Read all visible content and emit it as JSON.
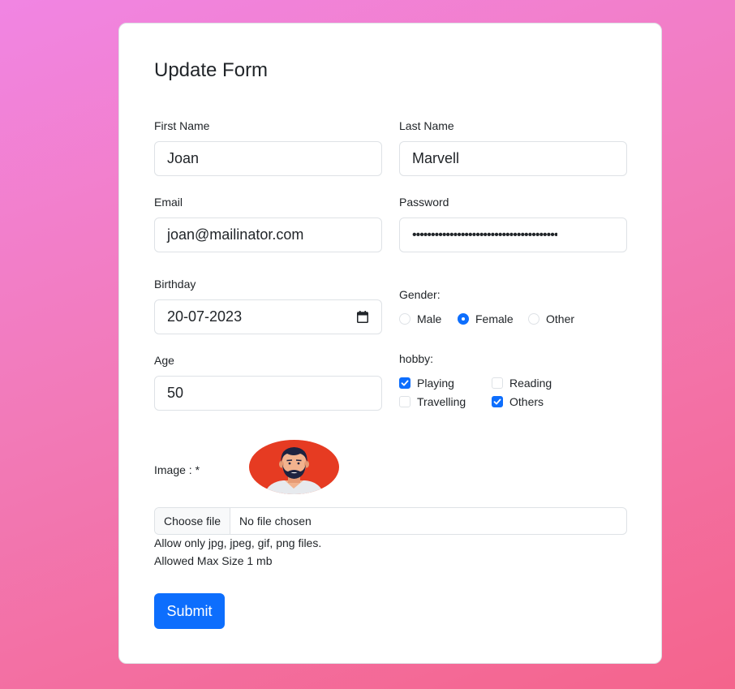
{
  "form": {
    "title": "Update Form",
    "first_name": {
      "label": "First Name",
      "value": "Joan"
    },
    "last_name": {
      "label": "Last Name",
      "value": "Marvell"
    },
    "email": {
      "label": "Email",
      "value": "joan@mailinator.com"
    },
    "password": {
      "label": "Password",
      "value": "•••••••••••••••••••••••••••••••••••••••"
    },
    "birthday": {
      "label": "Birthday",
      "value": "20-07-2023",
      "icon": "calendar-icon"
    },
    "gender": {
      "label": "Gender:",
      "options": [
        "Male",
        "Female",
        "Other"
      ],
      "selected": "Female"
    },
    "age": {
      "label": "Age",
      "value": "50"
    },
    "hobby": {
      "label": "hobby:",
      "options": [
        {
          "label": "Playing",
          "checked": true
        },
        {
          "label": "Reading",
          "checked": false
        },
        {
          "label": "Travelling",
          "checked": false
        },
        {
          "label": "Others",
          "checked": true
        }
      ]
    },
    "image": {
      "label": "Image : *",
      "avatar_icon": "avatar-icon",
      "file_button": "Choose file",
      "file_status": "No file chosen",
      "hint_types": "Allow only jpg, jpeg, gif, png files.",
      "hint_size": "Allowed Max Size 1 mb"
    },
    "submit_label": "Submit"
  },
  "colors": {
    "accent": "#0d6efd",
    "avatar_bg": "#e63b22"
  }
}
